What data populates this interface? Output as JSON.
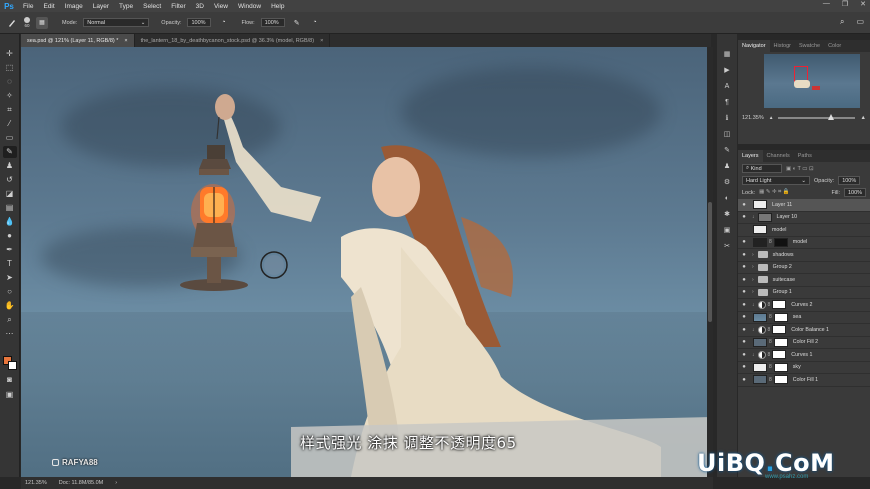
{
  "app": {
    "logo": "Ps"
  },
  "menu": [
    "File",
    "Edit",
    "Image",
    "Layer",
    "Type",
    "Select",
    "Filter",
    "3D",
    "View",
    "Window",
    "Help"
  ],
  "window_controls": [
    "—",
    "❐",
    "✕"
  ],
  "options": {
    "brush_size": "60",
    "mode_label": "Mode:",
    "mode_value": "Normal",
    "opacity_label": "Opacity:",
    "opacity_value": "100%",
    "flow_label": "Flow:",
    "flow_value": "100%"
  },
  "tabs": [
    {
      "label": "sea.psd @ 121% (Layer 11, RGB/8) *",
      "close": "×"
    },
    {
      "label": "the_lantern_18_by_deathbycanon_stock.psd @ 36.3% (model, RGB/8)",
      "close": "×"
    }
  ],
  "status": {
    "zoom": "121.35%",
    "doc": "Doc: 11.8M/85.0M",
    "arrow": "›"
  },
  "navigator": {
    "tabs": [
      "Navigator",
      "Histogr",
      "Swatche",
      "Color"
    ],
    "zoom": "121.35%"
  },
  "layers_panel": {
    "tabs": [
      "Layers",
      "Channels",
      "Paths"
    ],
    "filter_label": "Kind",
    "blend_mode": "Hard Light",
    "opacity_label": "Opacity:",
    "opacity_value": "100%",
    "lock_label": "Lock:",
    "fill_label": "Fill:",
    "fill_value": "100%",
    "layers": [
      {
        "name": "Layer 11",
        "thumb": "light",
        "selected": true,
        "kind": "pixel"
      },
      {
        "name": "Layer 10",
        "thumb": "gray",
        "kind": "pixel"
      },
      {
        "name": "model",
        "thumb": "light",
        "kind": "pixel"
      },
      {
        "name": "model",
        "thumb": "dark",
        "kind": "masked"
      },
      {
        "name": "shadows",
        "kind": "group"
      },
      {
        "name": "Group 2",
        "kind": "group"
      },
      {
        "name": "suitecase",
        "kind": "group"
      },
      {
        "name": "Group 1",
        "kind": "group"
      },
      {
        "name": "Curves 2",
        "kind": "adjustment"
      },
      {
        "name": "sea",
        "thumb": "sea",
        "kind": "masked"
      },
      {
        "name": "Color Balance 1",
        "kind": "adjustment"
      },
      {
        "name": "Color Fill 2",
        "thumb": "slate",
        "kind": "fill"
      },
      {
        "name": "Curves 1",
        "kind": "adjustment"
      },
      {
        "name": "sky",
        "thumb": "light",
        "kind": "masked"
      },
      {
        "name": "Color Fill 1",
        "thumb": "slate",
        "kind": "fill"
      }
    ]
  },
  "subtitle": "样式强光  涂抹  调整不透明度65",
  "watermark_left": "RAFYA88",
  "watermark_right": {
    "part1": "UiBQ",
    "part2": ".",
    "part3": "CoM"
  },
  "watermark_small": "www.psahz.com",
  "colors": {
    "foreground": "#e8763c",
    "background": "#ffffff",
    "accent": "#31a8ff"
  }
}
